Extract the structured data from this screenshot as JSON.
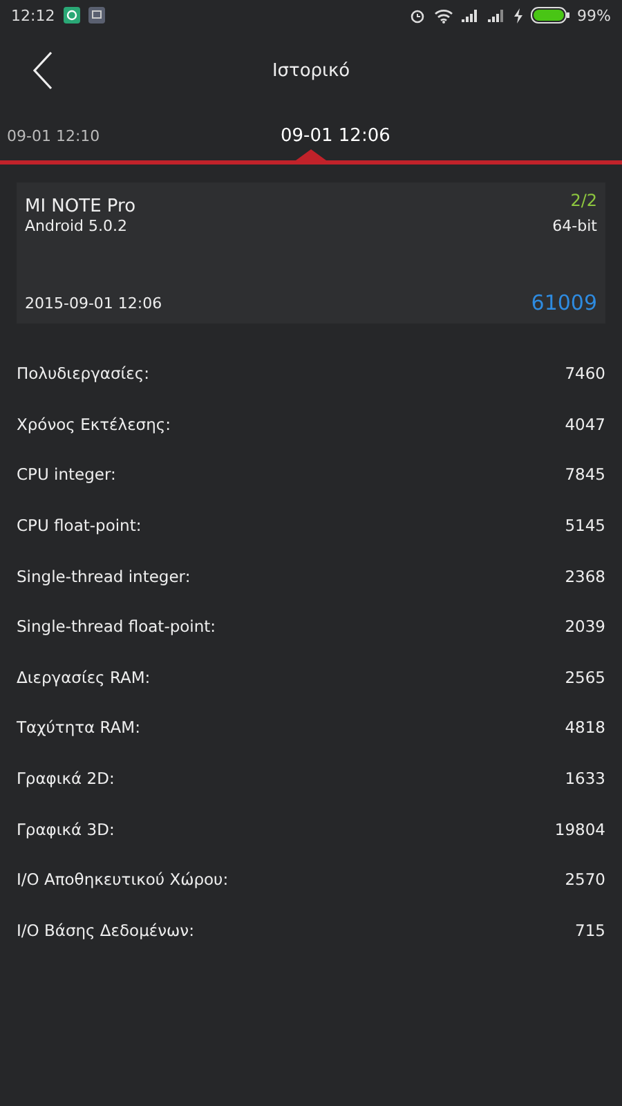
{
  "status_bar": {
    "time": "12:12",
    "battery_text": "99%"
  },
  "header": {
    "title": "Ιστορικό"
  },
  "tabs": [
    {
      "label": "09-01 12:10",
      "selected": false
    },
    {
      "label": "09-01 12:06",
      "selected": true
    }
  ],
  "card": {
    "device": "MI NOTE Pro",
    "os": "Android 5.0.2",
    "page": "2/2",
    "arch": "64-bit",
    "date": "2015-09-01 12:06",
    "score": "61009"
  },
  "results": [
    {
      "label": "Πολυδιεργασίες:",
      "value": "7460"
    },
    {
      "label": "Χρόνος Εκτέλεσης:",
      "value": "4047"
    },
    {
      "label": "CPU integer:",
      "value": "7845"
    },
    {
      "label": "CPU float-point:",
      "value": "5145"
    },
    {
      "label": "Single-thread integer:",
      "value": "2368"
    },
    {
      "label": "Single-thread float-point:",
      "value": "2039"
    },
    {
      "label": "Διεργασίες RAM:",
      "value": "2565"
    },
    {
      "label": "Ταχύτητα RAM:",
      "value": "4818"
    },
    {
      "label": "Γραφικά 2D:",
      "value": "1633"
    },
    {
      "label": "Γραφικά 3D:",
      "value": "19804"
    },
    {
      "label": "I/O Αποθηκευτικού Χώρου:",
      "value": "2570"
    },
    {
      "label": "I/O Βάσης Δεδομένων:",
      "value": "715"
    }
  ]
}
